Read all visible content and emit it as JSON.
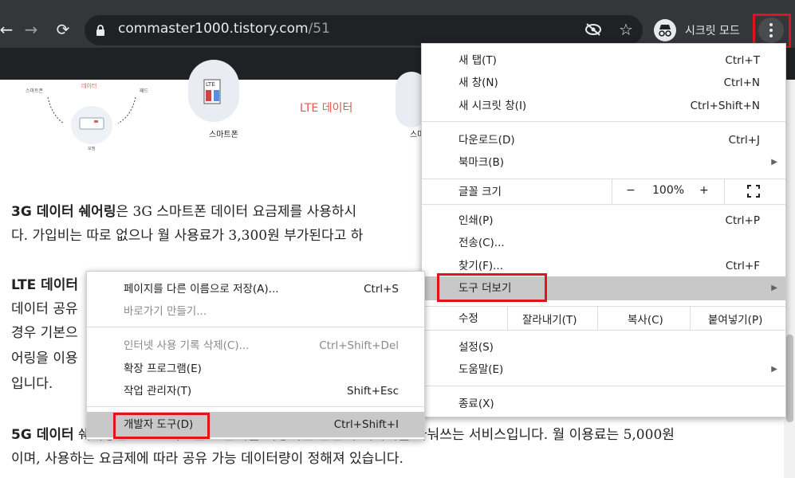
{
  "toolbar": {
    "url_host": "commaster1000.tistory.com",
    "url_path": "/51",
    "incognito_label": "시크릿 모드"
  },
  "article": {
    "fig_labels": [
      "스마트폰",
      "LTE 데이터",
      "스마"
    ],
    "lines": [
      {
        "bold": "3G 데이터 쉐어링",
        "text": "은 3G 스마트폰 데이터 요금제를 사용하시"
      },
      {
        "bold": "",
        "text": "다. 가입비는 따로 없으나 월 사용료가 3,300원 부가된다고 하"
      },
      {
        "bold": "LTE 데이터",
        "text": ""
      },
      {
        "bold": "",
        "text": "데이터 공유"
      },
      {
        "bold": "",
        "text": "경우 기본으"
      },
      {
        "bold": "",
        "text": "어링을 이용"
      },
      {
        "bold": "",
        "text": "입니다."
      },
      {
        "bold": "5G 데이터",
        "text": " 쉐어링은 5G 스마트폰 요금제를 사용하는 분들이 데이터를 나눠쓰는 서비스입니다. 월 이용료는 5,000원"
      },
      {
        "bold": "",
        "text": "이며, 사용하는 요금제에 따라 공유 가능 데이터량이 정해져 있습니다."
      }
    ]
  },
  "main_menu": {
    "items": [
      {
        "label": "새 탭(T)",
        "shortcut": "Ctrl+T"
      },
      {
        "label": "새 창(N)",
        "shortcut": "Ctrl+N"
      },
      {
        "label": "새 시크릿 창(I)",
        "shortcut": "Ctrl+Shift+N"
      },
      {
        "label": "다운로드(D)",
        "shortcut": "Ctrl+J"
      },
      {
        "label": "북마크(B)",
        "shortcut": ""
      },
      {
        "label": "글꼴 크기",
        "shortcut": ""
      },
      {
        "label": "인쇄(P)",
        "shortcut": "Ctrl+P"
      },
      {
        "label": "전송(C)...",
        "shortcut": ""
      },
      {
        "label": "찾기(F)...",
        "shortcut": "Ctrl+F"
      },
      {
        "label": "도구 더보기",
        "shortcut": ""
      },
      {
        "label": "수정",
        "shortcut": ""
      },
      {
        "label": "설정(S)",
        "shortcut": ""
      },
      {
        "label": "도움말(E)",
        "shortcut": ""
      },
      {
        "label": "종료(X)",
        "shortcut": ""
      }
    ],
    "zoom": {
      "minus": "−",
      "value": "100%",
      "plus": "+"
    },
    "edit": {
      "cut": "잘라내기(T)",
      "copy": "복사(C)",
      "paste": "붙여넣기(P)"
    }
  },
  "sub_menu": {
    "items": [
      {
        "label": "페이지를 다른 이름으로 저장(A)...",
        "shortcut": "Ctrl+S",
        "disabled": false
      },
      {
        "label": "바로가기 만들기...",
        "shortcut": "",
        "disabled": true
      },
      {
        "label": "인터넷 사용 기록 삭제(C)...",
        "shortcut": "Ctrl+Shift+Del",
        "disabled": true
      },
      {
        "label": "확장 프로그램(E)",
        "shortcut": "",
        "disabled": false
      },
      {
        "label": "작업 관리자(T)",
        "shortcut": "Shift+Esc",
        "disabled": false
      },
      {
        "label": "개발자 도구(D)",
        "shortcut": "Ctrl+Shift+I",
        "disabled": false
      }
    ]
  },
  "colors": {
    "highlight": "#e0141c",
    "toolbar": "#35363a"
  }
}
